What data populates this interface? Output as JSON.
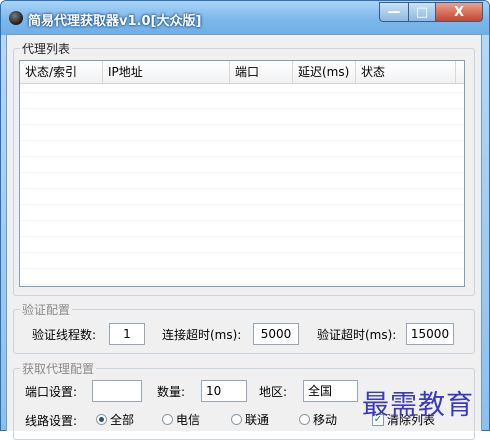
{
  "window": {
    "title": "简易代理获取器v1.0[大众版]",
    "controls": {
      "minimize": "—",
      "maximize": "□",
      "close": "X"
    }
  },
  "proxy_list": {
    "legend": "代理列表",
    "columns": [
      "状态/索引",
      "IP地址",
      "端口",
      "延迟(ms)",
      "状态"
    ]
  },
  "verify_config": {
    "legend": "验证配置",
    "threads_label": "验证线程数:",
    "threads_value": "1",
    "connect_timeout_label": "连接超时(ms):",
    "connect_timeout_value": "5000",
    "verify_timeout_label": "验证超时(ms):",
    "verify_timeout_value": "15000"
  },
  "fetch_config": {
    "legend": "获取代理配置",
    "port_label": "端口设置:",
    "port_value": "",
    "count_label": "数量:",
    "count_value": "10",
    "region_label": "地区:",
    "region_value": "全国",
    "line_label": "线路设置:",
    "line_options": [
      "全部",
      "电信",
      "联通",
      "移动"
    ],
    "line_selected": "全部",
    "clear_list_label": "清除列表",
    "clear_list_checked": true
  },
  "watermark": "最需教育"
}
